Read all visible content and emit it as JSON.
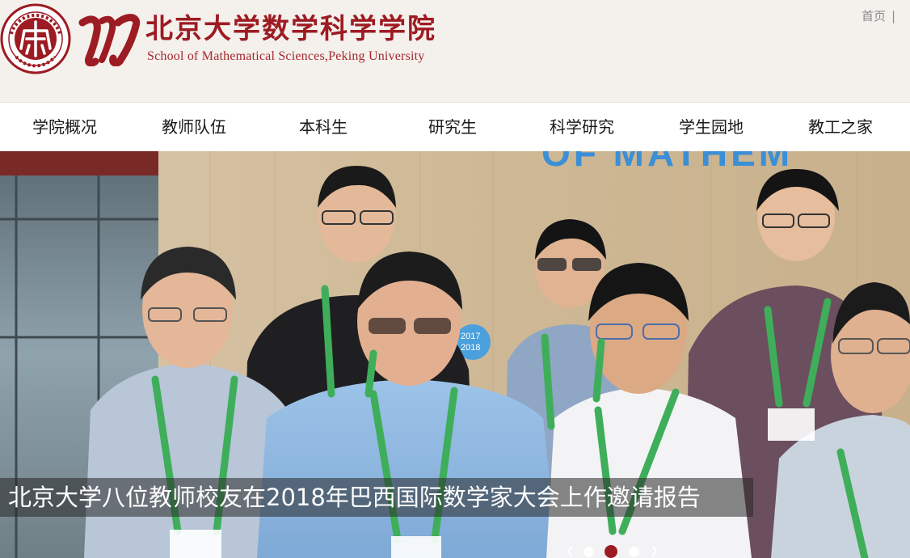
{
  "header": {
    "title_cn": "北京大学数学科学学院",
    "title_en": "School of Mathematical Sciences,Peking University",
    "home_link": "首页",
    "separator": "|",
    "seal_icon": "peking-university-seal",
    "brand_color": "#9d1b22"
  },
  "nav": {
    "items": [
      {
        "label": "学院概况"
      },
      {
        "label": "教师队伍"
      },
      {
        "label": "本科生"
      },
      {
        "label": "研究生"
      },
      {
        "label": "科学研究"
      },
      {
        "label": "学生园地"
      },
      {
        "label": "教工之家"
      }
    ]
  },
  "banner": {
    "caption": "北京大学八位教师校友在2018年巴西国际数学家大会上作邀请报告",
    "slides_total": 3,
    "active_slide": 2,
    "prev_icon": "chevron-left-icon",
    "next_icon": "chevron-right-icon"
  }
}
